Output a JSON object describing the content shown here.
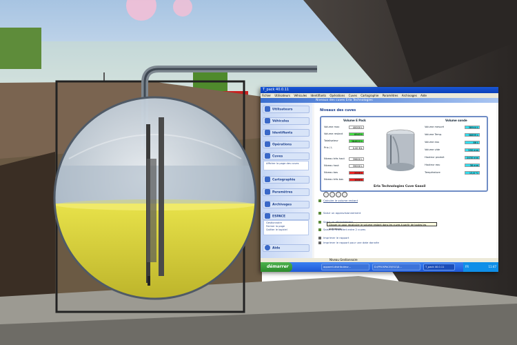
{
  "window": {
    "title": "T_pack 40.0.11"
  },
  "menu": [
    "Fichier",
    "Utilisateurs",
    "Véhicules",
    "Identifiants",
    "Opérations",
    "Cuves",
    "Cartographie",
    "Paramètres",
    "Archivages",
    "Aide"
  ],
  "banner": "Niveaux des cuves Erla Technologies",
  "sidebar": {
    "items": [
      {
        "label": "Utilisateurs",
        "icon": "users-icon"
      },
      {
        "label": "Véhicules",
        "icon": "truck-icon"
      },
      {
        "label": "Identifiants",
        "icon": "key-icon"
      },
      {
        "label": "Opérations",
        "icon": "fuel-icon"
      },
      {
        "label": "Cuves",
        "icon": "tank-icon"
      },
      {
        "label": "Cartographie",
        "icon": "map-icon"
      },
      {
        "label": "Paramètres",
        "icon": "gear-icon"
      },
      {
        "label": "Archivages",
        "icon": "archive-icon"
      },
      {
        "label": "ESPACE",
        "icon": "space-icon"
      },
      {
        "label": "Aide",
        "icon": "help-icon"
      }
    ],
    "cuves_sub": "Afficher la page des cuves",
    "espace_sub": [
      "Gestionnaire",
      "Fermer la page",
      "Quitter le logiciel"
    ]
  },
  "content": {
    "section_title": "Niveaux des cuves",
    "left_header": "Volume E Pack",
    "right_header": "Volume sonde",
    "left_rows": [
      {
        "label": "Volume max",
        "value": "40000 L",
        "color": "#ffffff"
      },
      {
        "label": "Volume restant",
        "value": "6943 L",
        "color": "#44dd44"
      },
      {
        "label": "Totalisateur",
        "value": "384622 L",
        "color": "#44dd44"
      },
      {
        "label": "Prix / L",
        "value": "0.00 €/L",
        "color": "#ffffff"
      },
      {
        "label": "Niveau très haut",
        "value": "39600 L",
        "color": "#ffffff"
      },
      {
        "label": "Niveau haut",
        "value": "39000 L",
        "color": "#ffffff"
      },
      {
        "label": "Niveau bas",
        "value": "2000 L",
        "color": "#ee2222"
      },
      {
        "label": "Niveau très bas",
        "value": "1000 L",
        "color": "#ee2222"
      }
    ],
    "right_rows": [
      {
        "label": "Volume mesuré",
        "value": "38944 L",
        "color": "#33ddee"
      },
      {
        "label": "Volume Temp.",
        "value": "38899 L",
        "color": "#33ddee"
      },
      {
        "label": "Volume eau",
        "value": "86 L",
        "color": "#33ddee"
      },
      {
        "label": "Volume vide",
        "value": "590 mm",
        "color": "#33ddee"
      },
      {
        "label": "Hauteur produit",
        "value": "2430 mm",
        "color": "#33ddee"
      },
      {
        "label": "Hauteur eau",
        "value": "38 mm",
        "color": "#33ddee"
      },
      {
        "label": "Température",
        "value": "13,8 °C",
        "color": "#33ddee"
      }
    ],
    "panel_footer": "Erla Technologies Cuve Gasoil",
    "actions": [
      "Calculer le volume restant",
      "Saisir un approvisionnement",
      "Saisir un réajustement",
      "Saisir un transfert entre 2 cuves",
      "Imprimer le rapport",
      "Imprimer le rapport pour une date donnée"
    ],
    "tooltip": "Cliquer ici pour recalculer le volume restant dans les cuves à partir de toutes les opérations"
  },
  "statusbar": "Niveau Gestionnaire",
  "taskbar": {
    "start": "démarrer",
    "tasks": [
      "appareil-distributeur...",
      "D:\\PROSPACE\\ESC\\D...",
      "T_pack 40.0.11"
    ],
    "lang": "FR",
    "clock": "11:47"
  }
}
